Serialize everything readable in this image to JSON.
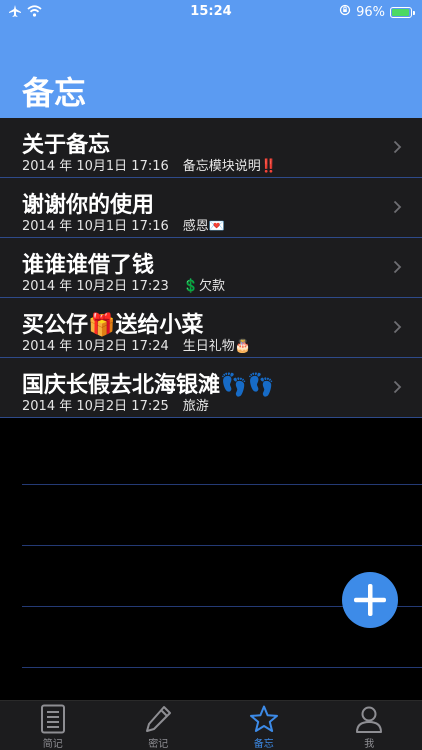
{
  "status_bar": {
    "time": "15:24",
    "battery": "96%",
    "battery_level": 0.96
  },
  "header": {
    "title": "备忘"
  },
  "memos": [
    {
      "title": "关于备忘",
      "date": "2014 年 10月1日 17:16",
      "note": "备忘模块说明‼️"
    },
    {
      "title": "谢谢你的使用",
      "date": "2014 年 10月1日 17:16",
      "note": "感恩💌"
    },
    {
      "title": "谁谁谁借了钱",
      "date": "2014 年 10月2日 17:23",
      "note": "💲欠款"
    },
    {
      "title": "买公仔🎁送给小菜",
      "date": "2014 年 10月2日 17:24",
      "note": "生日礼物🎂"
    },
    {
      "title": "国庆长假去北海银滩👣👣",
      "date": "2014 年 10月2日 17:25",
      "note": "旅游"
    }
  ],
  "fab": {
    "icon": "plus-icon"
  },
  "tabs": [
    {
      "label": "简记",
      "icon": "notebook-icon"
    },
    {
      "label": "密记",
      "icon": "pencil-icon"
    },
    {
      "label": "备忘",
      "icon": "star-icon"
    },
    {
      "label": "我",
      "icon": "person-icon"
    }
  ],
  "colors": {
    "header_bg": "#5b9bf2",
    "accent": "#3d8be8",
    "row_bg": "#1c1c1e",
    "separator": "#2e4a8a"
  }
}
